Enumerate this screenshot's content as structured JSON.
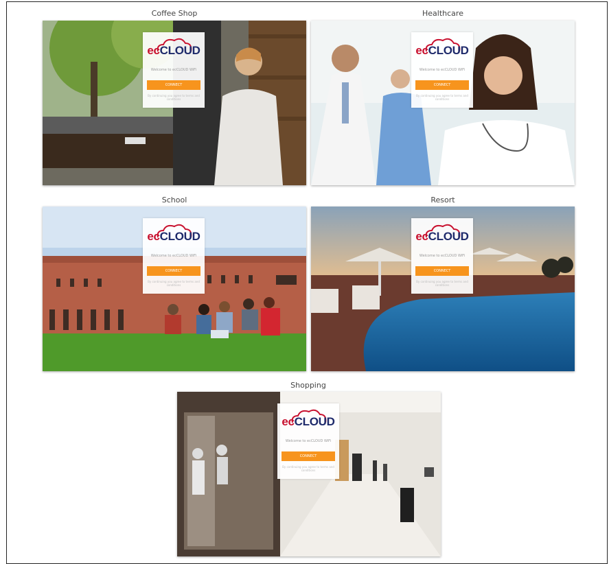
{
  "scenarios": [
    {
      "title": "Coffee Shop"
    },
    {
      "title": "Healthcare"
    },
    {
      "title": "School"
    },
    {
      "title": "Resort"
    },
    {
      "title": "Shopping"
    }
  ],
  "portal": {
    "logo_ec": "ec",
    "logo_cloud": "CLOUD",
    "welcome": "Welcome to ecCLOUD WiFi",
    "connect": "CONNECT",
    "terms": "By continuing you agree to terms and conditions"
  },
  "colors": {
    "connect_button": "#f7941d",
    "logo_red": "#c8102e",
    "logo_navy": "#1e2a6b"
  }
}
